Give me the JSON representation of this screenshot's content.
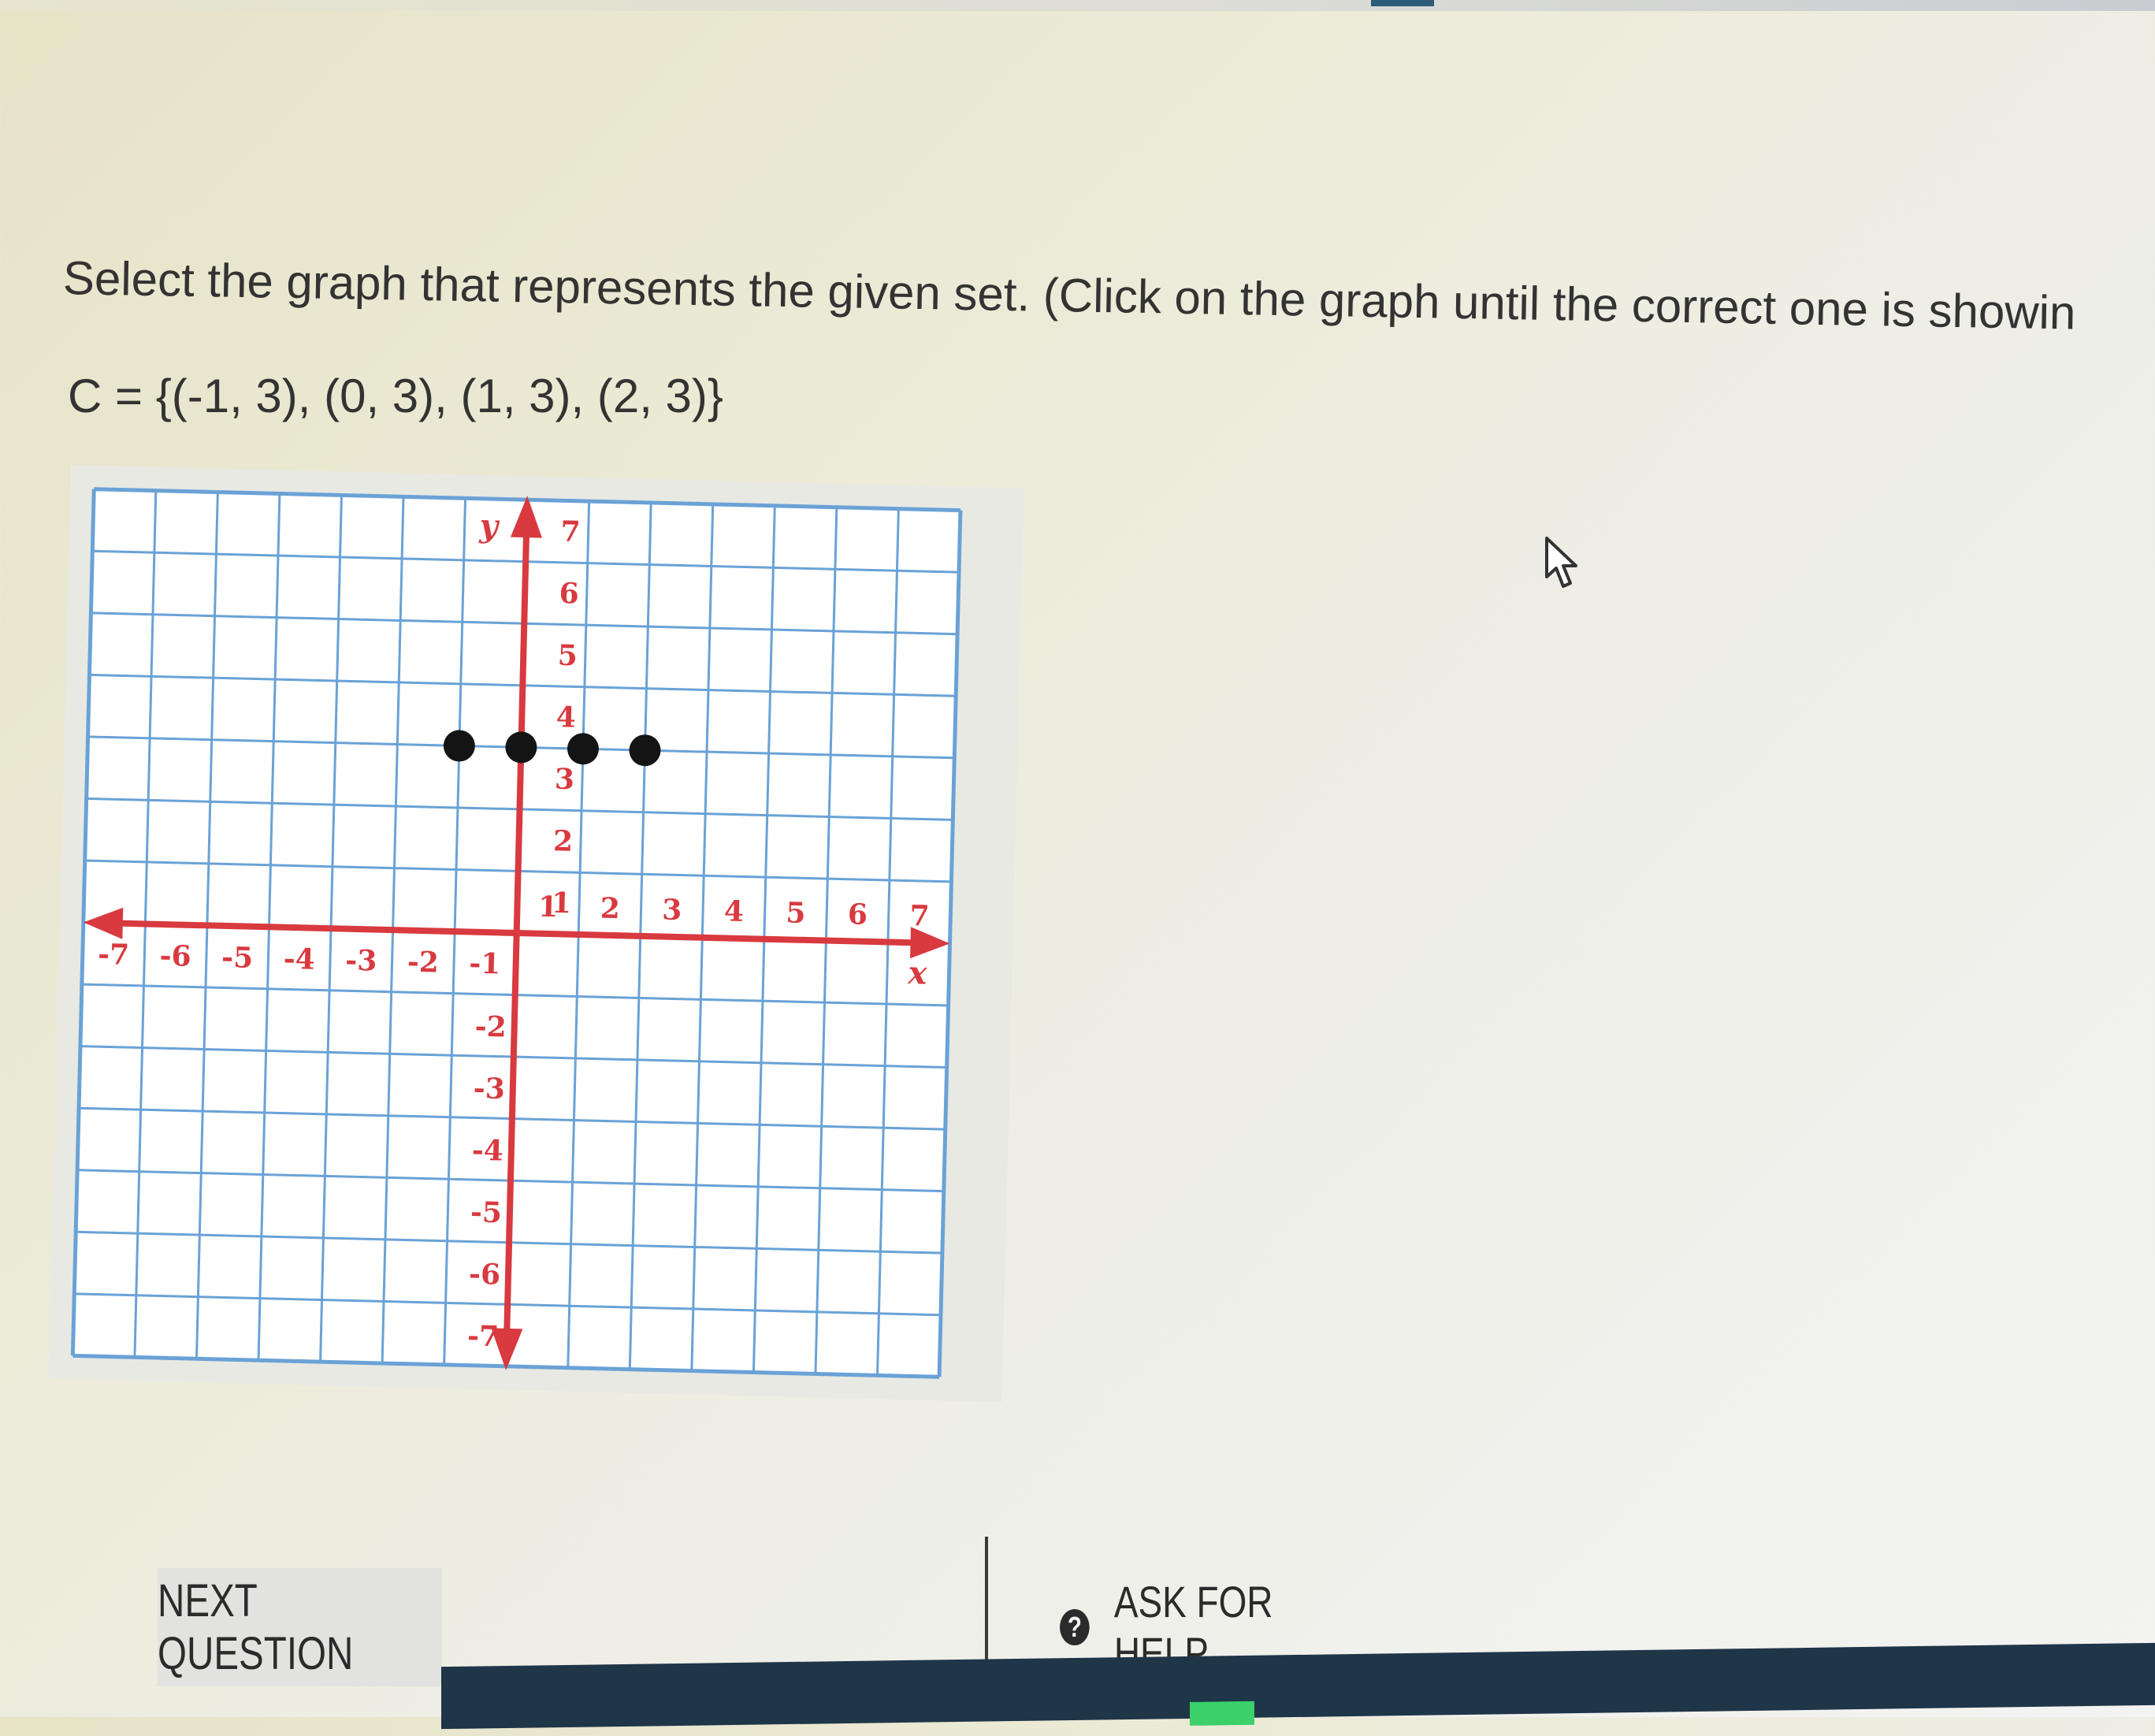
{
  "question": {
    "prompt": "Select the graph that represents the given set. (Click on the graph until the correct one is showin",
    "set_expression": "C = {(-1, 3), (0, 3), (1, 3), (2, 3)}"
  },
  "graph": {
    "x_axis_label": "x",
    "y_axis_label": "y",
    "x_tick_labels": [
      "-7",
      "-6",
      "-5",
      "-4",
      "-3",
      "-2",
      "-1",
      "1",
      "2",
      "3",
      "4",
      "5",
      "6",
      "7"
    ],
    "y_tick_labels": [
      "7",
      "6",
      "5",
      "4",
      "3",
      "2",
      "1",
      "-2",
      "-3",
      "-4",
      "-5",
      "-6",
      "-7"
    ],
    "x_range": [
      -7,
      7
    ],
    "y_range": [
      -7,
      7
    ],
    "plotted_points": [
      [
        -1,
        3
      ],
      [
        0,
        3
      ],
      [
        1,
        3
      ],
      [
        2,
        3
      ]
    ],
    "grid": true,
    "colors": {
      "grid": "#6aa2d6",
      "axes": "#d83a3f",
      "tick_labels": "#d83a3f",
      "points": "#141414",
      "panel": "#ffffff"
    }
  },
  "footer": {
    "next_label": "NEXT QUESTION",
    "help_label": "ASK FOR HELP",
    "help_icon": "?"
  },
  "icons": {
    "cursor": "mouse-pointer-icon",
    "help": "question-circle-icon"
  }
}
